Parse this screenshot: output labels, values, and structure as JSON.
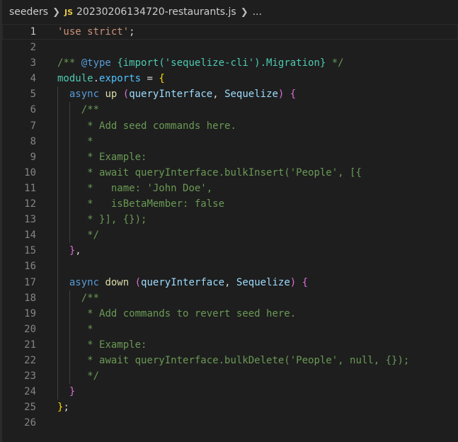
{
  "breadcrumb": {
    "folder": "seeders",
    "file_icon": "JS",
    "file": "20230206134720-restaurants.js",
    "trail": "..."
  },
  "colors": {
    "background": "#1e1e1e",
    "line_number": "#858585",
    "string": "#ce9178",
    "comment": "#6a9955",
    "keyword": "#569cd6",
    "type": "#4ec9b0",
    "function": "#dcdcaa",
    "variable": "#9cdcfe"
  },
  "lines": [
    {
      "n": "1",
      "active": true,
      "guides": 0,
      "tokens": [
        {
          "c": "t-str",
          "t": "'use strict'"
        },
        {
          "c": "t-punc",
          "t": ";"
        }
      ]
    },
    {
      "n": "2",
      "guides": 0,
      "tokens": []
    },
    {
      "n": "3",
      "guides": 0,
      "tokens": [
        {
          "c": "t-com",
          "t": "/** "
        },
        {
          "c": "t-tag",
          "t": "@type"
        },
        {
          "c": "t-com",
          "t": " "
        },
        {
          "c": "t-type",
          "t": "{import('sequelize-cli').Migration}"
        },
        {
          "c": "t-com",
          "t": " */"
        }
      ]
    },
    {
      "n": "4",
      "guides": 0,
      "tokens": [
        {
          "c": "t-type",
          "t": "module"
        },
        {
          "c": "t-punc",
          "t": "."
        },
        {
          "c": "t-obj",
          "t": "exports"
        },
        {
          "c": "t-punc",
          "t": " = "
        },
        {
          "c": "t-brace1",
          "t": "{"
        }
      ]
    },
    {
      "n": "5",
      "guides": 1,
      "tokens": [
        {
          "c": "t-punc",
          "t": "  "
        },
        {
          "c": "t-kw",
          "t": "async"
        },
        {
          "c": "t-punc",
          "t": " "
        },
        {
          "c": "t-fn",
          "t": "up"
        },
        {
          "c": "t-punc",
          "t": " "
        },
        {
          "c": "t-brace2",
          "t": "("
        },
        {
          "c": "t-var",
          "t": "queryInterface"
        },
        {
          "c": "t-punc",
          "t": ", "
        },
        {
          "c": "t-var",
          "t": "Sequelize"
        },
        {
          "c": "t-brace2",
          "t": ")"
        },
        {
          "c": "t-punc",
          "t": " "
        },
        {
          "c": "t-brace2",
          "t": "{"
        }
      ]
    },
    {
      "n": "6",
      "guides": 2,
      "tokens": [
        {
          "c": "t-punc",
          "t": "    "
        },
        {
          "c": "t-com",
          "t": "/**"
        }
      ]
    },
    {
      "n": "7",
      "guides": 2,
      "tokens": [
        {
          "c": "t-punc",
          "t": "     "
        },
        {
          "c": "t-com",
          "t": "* Add seed commands here."
        }
      ]
    },
    {
      "n": "8",
      "guides": 2,
      "tokens": [
        {
          "c": "t-punc",
          "t": "     "
        },
        {
          "c": "t-com",
          "t": "*"
        }
      ]
    },
    {
      "n": "9",
      "guides": 2,
      "tokens": [
        {
          "c": "t-punc",
          "t": "     "
        },
        {
          "c": "t-com",
          "t": "* Example:"
        }
      ]
    },
    {
      "n": "10",
      "guides": 2,
      "tokens": [
        {
          "c": "t-punc",
          "t": "     "
        },
        {
          "c": "t-com",
          "t": "* await queryInterface.bulkInsert('People', [{"
        }
      ]
    },
    {
      "n": "11",
      "guides": 2,
      "tokens": [
        {
          "c": "t-punc",
          "t": "     "
        },
        {
          "c": "t-com",
          "t": "*   name: 'John Doe',"
        }
      ]
    },
    {
      "n": "12",
      "guides": 2,
      "tokens": [
        {
          "c": "t-punc",
          "t": "     "
        },
        {
          "c": "t-com",
          "t": "*   isBetaMember: false"
        }
      ]
    },
    {
      "n": "13",
      "guides": 2,
      "tokens": [
        {
          "c": "t-punc",
          "t": "     "
        },
        {
          "c": "t-com",
          "t": "* }], {});"
        }
      ]
    },
    {
      "n": "14",
      "guides": 2,
      "tokens": [
        {
          "c": "t-punc",
          "t": "    "
        },
        {
          "c": "t-com",
          "t": " */"
        }
      ]
    },
    {
      "n": "15",
      "guides": 1,
      "tokens": [
        {
          "c": "t-punc",
          "t": "  "
        },
        {
          "c": "t-brace2",
          "t": "}"
        },
        {
          "c": "t-punc",
          "t": ","
        }
      ]
    },
    {
      "n": "16",
      "guides": 1,
      "tokens": []
    },
    {
      "n": "17",
      "guides": 1,
      "tokens": [
        {
          "c": "t-punc",
          "t": "  "
        },
        {
          "c": "t-kw",
          "t": "async"
        },
        {
          "c": "t-punc",
          "t": " "
        },
        {
          "c": "t-fn",
          "t": "down"
        },
        {
          "c": "t-punc",
          "t": " "
        },
        {
          "c": "t-brace2",
          "t": "("
        },
        {
          "c": "t-var",
          "t": "queryInterface"
        },
        {
          "c": "t-punc",
          "t": ", "
        },
        {
          "c": "t-var",
          "t": "Sequelize"
        },
        {
          "c": "t-brace2",
          "t": ")"
        },
        {
          "c": "t-punc",
          "t": " "
        },
        {
          "c": "t-brace2",
          "t": "{"
        }
      ]
    },
    {
      "n": "18",
      "guides": 2,
      "tokens": [
        {
          "c": "t-punc",
          "t": "    "
        },
        {
          "c": "t-com",
          "t": "/**"
        }
      ]
    },
    {
      "n": "19",
      "guides": 2,
      "tokens": [
        {
          "c": "t-punc",
          "t": "     "
        },
        {
          "c": "t-com",
          "t": "* Add commands to revert seed here."
        }
      ]
    },
    {
      "n": "20",
      "guides": 2,
      "tokens": [
        {
          "c": "t-punc",
          "t": "     "
        },
        {
          "c": "t-com",
          "t": "*"
        }
      ]
    },
    {
      "n": "21",
      "guides": 2,
      "tokens": [
        {
          "c": "t-punc",
          "t": "     "
        },
        {
          "c": "t-com",
          "t": "* Example:"
        }
      ]
    },
    {
      "n": "22",
      "guides": 2,
      "tokens": [
        {
          "c": "t-punc",
          "t": "     "
        },
        {
          "c": "t-com",
          "t": "* await queryInterface.bulkDelete('People', null, {});"
        }
      ]
    },
    {
      "n": "23",
      "guides": 2,
      "tokens": [
        {
          "c": "t-punc",
          "t": "    "
        },
        {
          "c": "t-com",
          "t": " */"
        }
      ]
    },
    {
      "n": "24",
      "guides": 1,
      "tokens": [
        {
          "c": "t-punc",
          "t": "  "
        },
        {
          "c": "t-brace2",
          "t": "}"
        }
      ]
    },
    {
      "n": "25",
      "guides": 0,
      "tokens": [
        {
          "c": "t-brace1",
          "t": "}"
        },
        {
          "c": "t-punc",
          "t": ";"
        }
      ]
    },
    {
      "n": "26",
      "guides": 0,
      "tokens": []
    }
  ]
}
